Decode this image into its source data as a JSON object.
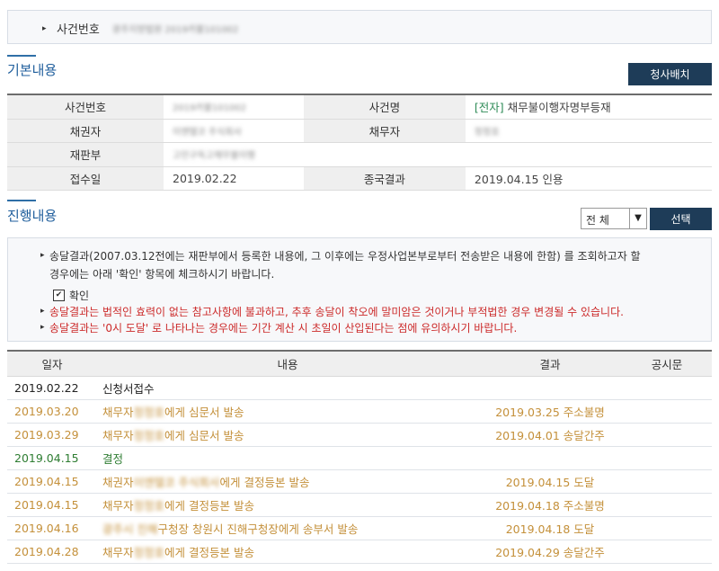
{
  "case_bar": {
    "label": "사건번호",
    "value": "광주지방법원 2019카불101002"
  },
  "basic_info": {
    "title": "기본내용",
    "button": "청사배치",
    "rows": [
      {
        "label1": "사건번호",
        "value1": "2019카불101002",
        "label2": "사건명",
        "tag": "[전자]",
        "value2": "채무불이행자명부등재"
      },
      {
        "label1": "채권자",
        "value1": "이엔텔코 주식회사",
        "label2": "채무자",
        "value2": "정정호"
      },
      {
        "label1": "재판부",
        "value1": "고민구독고채무불이행"
      },
      {
        "label1": "접수일",
        "value1": "2019.02.22",
        "label2": "종국결과",
        "value2": "2019.04.15 인용"
      }
    ]
  },
  "progress": {
    "title": "진행내용",
    "filter_value": "전 체",
    "select_button": "선택",
    "notice": {
      "line1": "송달결과(2007.03.12전에는 재판부에서 등록한 내용에, 그 이후에는 우정사업본부로부터 전송받은 내용에 한함) 를 조회하고자 할",
      "line2": "경우에는 아래 '확인' 항목에 체크하시기 바랍니다.",
      "checkbox_label": "확인",
      "warn1": "송달결과는 법적인 효력이 없는 참고사항에 불과하고, 추후 송달이 착오에 말미암은 것이거나 부적법한 경우 변경될 수 있습니다.",
      "warn2": "송달결과는 '0시 도달' 로 나타나는 경우에는 기간 계산 시 초일이 산입된다는 점에 유의하시기 바랍니다."
    },
    "columns": [
      "일자",
      "내용",
      "결과",
      "공시문"
    ],
    "rows": [
      {
        "date": "2019.02.22",
        "pre": "신청서접수",
        "redacted": "",
        "post": "",
        "result": "",
        "color": "black"
      },
      {
        "date": "2019.03.20",
        "pre": "채무자",
        "redacted": "정정호",
        "post": "에게 심문서 발송",
        "result": "2019.03.25 주소불명",
        "color": "orange"
      },
      {
        "date": "2019.03.29",
        "pre": "채무자",
        "redacted": "정정호",
        "post": "에게 심문서 발송",
        "result": "2019.04.01 송달간주",
        "color": "orange"
      },
      {
        "date": "2019.04.15",
        "pre": "결정",
        "redacted": "",
        "post": "",
        "result": "",
        "color": "green"
      },
      {
        "date": "2019.04.15",
        "pre": "채권자",
        "redacted": "이엔텔코 주식회사",
        "post": "에게 결정등본 발송",
        "result": "2019.04.15 도달",
        "color": "orange"
      },
      {
        "date": "2019.04.15",
        "pre": "채무자",
        "redacted": "정정호",
        "post": "에게 결정등본 발송",
        "result": "2019.04.18 주소불명",
        "color": "orange"
      },
      {
        "date": "2019.04.16",
        "pre": "",
        "redacted": "광주시 진해",
        "post": "구청장 창원시 진해구청장에게 송부서 발송",
        "result": "2019.04.18 도달",
        "color": "orange"
      },
      {
        "date": "2019.04.28",
        "pre": "채무자",
        "redacted": "정정호",
        "post": "에게 결정등본 발송",
        "result": "2019.04.29 송달간주",
        "color": "orange"
      }
    ]
  },
  "colors": {
    "accent": "#1f5e9c",
    "button": "#1e3c58",
    "orange": "#c4903a",
    "green": "#2e7d32",
    "red": "#cc2a2a"
  }
}
